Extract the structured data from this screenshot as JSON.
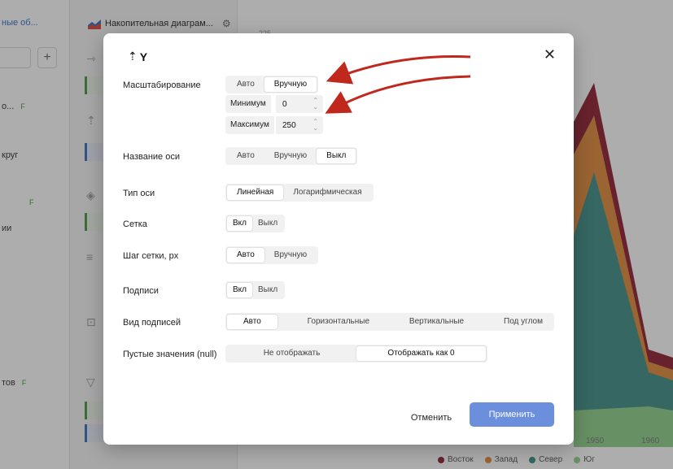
{
  "background": {
    "left_panel": {
      "header": "ные об...",
      "items": [
        {
          "label": "о...",
          "badge": "F"
        },
        {
          "label": "круг",
          "badge": ""
        },
        {
          "label": "",
          "badge": "F"
        },
        {
          "label": "ии",
          "badge": ""
        },
        {
          "label": "тов",
          "badge": "F"
        }
      ]
    },
    "middle_panel": {
      "chart_title": "Накопительная диаграм..."
    },
    "chart": {
      "y_tick": "225",
      "x_ticks": [
        "1950",
        "1960"
      ],
      "legend": [
        {
          "name": "Восток",
          "color": "#8e2031"
        },
        {
          "name": "Запад",
          "color": "#e08a3a"
        },
        {
          "name": "Север",
          "color": "#3f8f86"
        },
        {
          "name": "Юг",
          "color": "#8fd18a"
        }
      ]
    }
  },
  "dialog": {
    "title": "Y",
    "close_icon": "close-icon",
    "scaling": {
      "label": "Масштабирование",
      "options": [
        "Авто",
        "Вручную"
      ],
      "selected": "Вручную",
      "min_label": "Минимум",
      "min_value": "0",
      "max_label": "Максимум",
      "max_value": "250"
    },
    "axis_name": {
      "label": "Название оси",
      "options": [
        "Авто",
        "Вручную",
        "Выкл"
      ],
      "selected": "Выкл"
    },
    "axis_type": {
      "label": "Тип оси",
      "options": [
        "Линейная",
        "Логарифмическая"
      ],
      "selected": "Линейная"
    },
    "grid": {
      "label": "Сетка",
      "options": [
        "Вкл",
        "Выкл"
      ],
      "selected": "Вкл"
    },
    "grid_step": {
      "label": "Шаг сетки, px",
      "options": [
        "Авто",
        "Вручную"
      ],
      "selected": "Авто"
    },
    "captions": {
      "label": "Подписи",
      "options": [
        "Вкл",
        "Выкл"
      ],
      "selected": "Вкл"
    },
    "caption_view": {
      "label": "Вид подписей",
      "options": [
        "Авто",
        "Горизонтальные",
        "Вертикальные",
        "Под углом"
      ],
      "selected": "Авто"
    },
    "null_values": {
      "label": "Пустые значения (null)",
      "options": [
        "Не отображать",
        "Отображать как 0"
      ],
      "selected": "Отображать как 0"
    },
    "cancel_label": "Отменить",
    "apply_label": "Применить"
  },
  "colors": {
    "apply_button": "#6b8fdc",
    "annotation_arrow": "#c0281e"
  }
}
